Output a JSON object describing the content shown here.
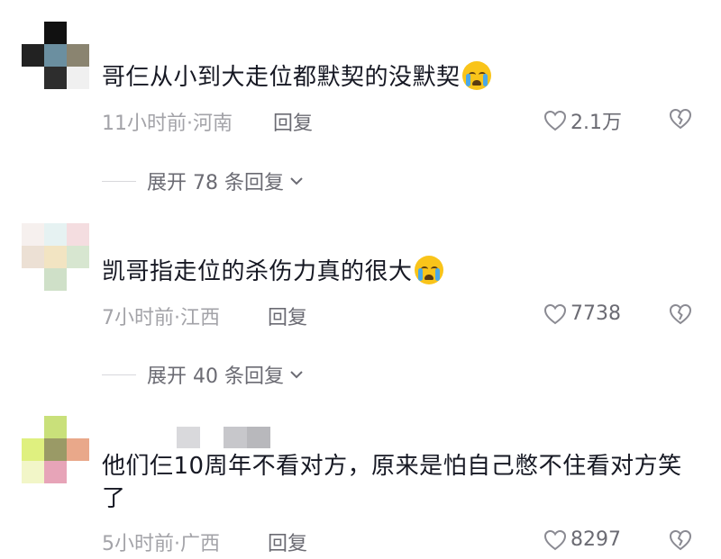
{
  "comments": [
    {
      "text": "哥仨从小到大走位都默契的没默契",
      "emoji": "loudly-crying-face",
      "time": "11小时前",
      "location": "河南",
      "reply_label": "回复",
      "likes": "2.1万",
      "expand_label": "展开 78 条回复",
      "avatar_colors": [
        "#ffffff",
        "#111111",
        "#ffffff",
        "#222222",
        "#6b8fa0",
        "#8a8470",
        "#ffffff",
        "#2d2d2d",
        "#f0f0f0"
      ]
    },
    {
      "text": "凯哥指走位的杀伤力真的很大",
      "emoji": "loudly-crying-face",
      "time": "7小时前",
      "location": "江西",
      "reply_label": "回复",
      "likes": "7738",
      "expand_label": "展开 40 条回复",
      "avatar_colors": [
        "#f6f0ee",
        "#e6f2f2",
        "#f4dde0",
        "#ece0d4",
        "#f2e4c2",
        "#d7e6d0",
        "#ffffff",
        "#cfe0c8",
        "#ffffff"
      ]
    },
    {
      "text": "他们仨10周年不看对方，原来是怕自己憋不住看对方笑了",
      "time": "5小时前",
      "location": "广西",
      "reply_label": "回复",
      "likes": "8297",
      "avatar_colors": [
        "#ffffff",
        "#c9e07a",
        "#ffffff",
        "#dff07f",
        "#9a9a66",
        "#e9a88a",
        "#f2f6c8",
        "#e7a4b8",
        "#ffffff"
      ]
    }
  ],
  "separator": "·",
  "colors": {
    "text": "#161823",
    "meta": "#a3a3a8",
    "action": "#6b6b73"
  }
}
